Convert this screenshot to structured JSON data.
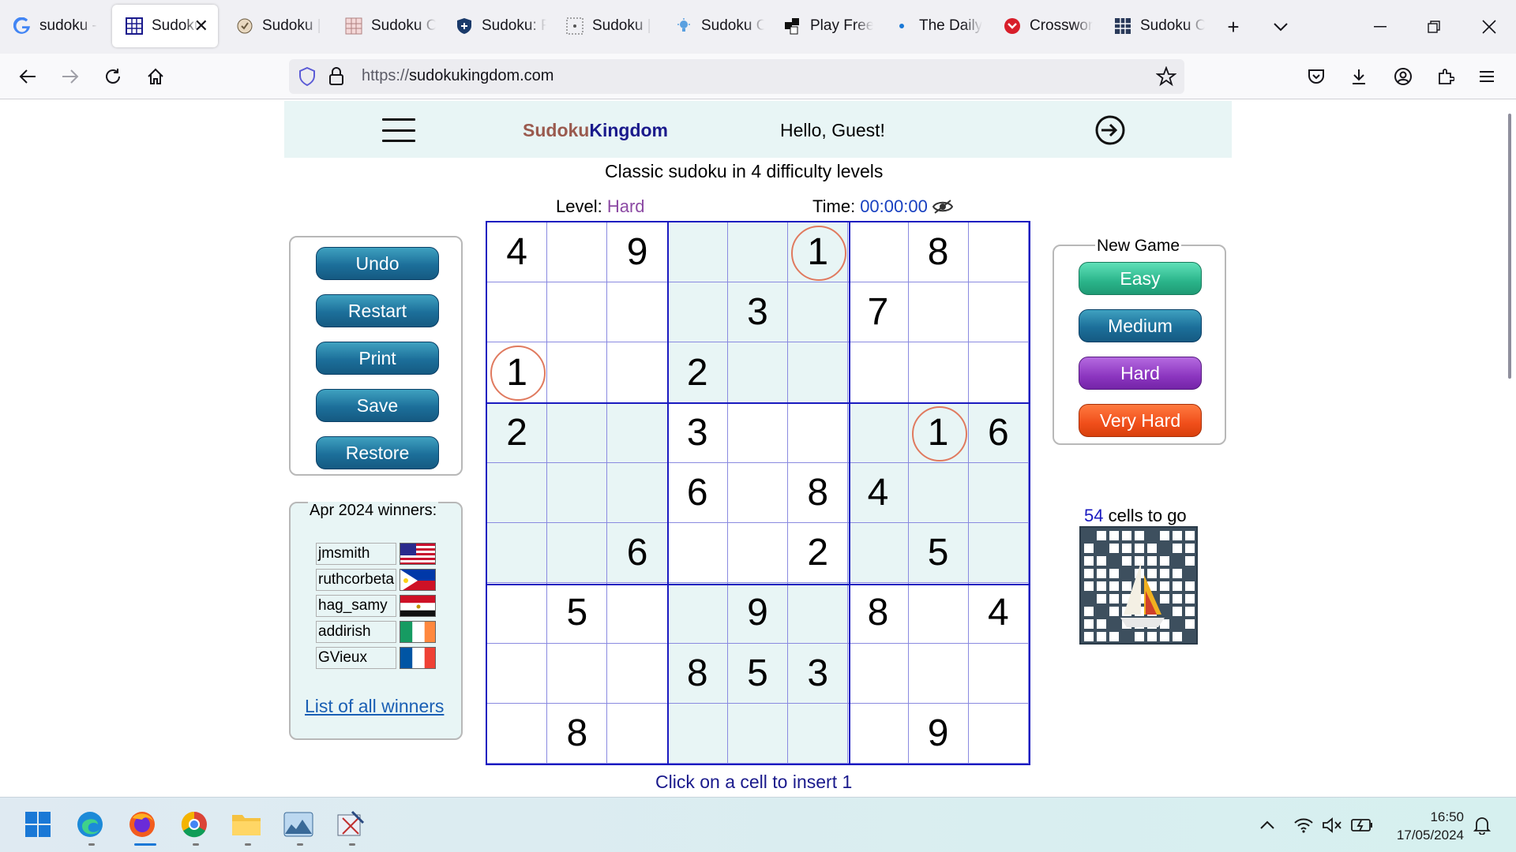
{
  "browser": {
    "tabs": [
      {
        "title": "sudoku -",
        "icon": "google-icon"
      },
      {
        "title": "Sudoku",
        "icon": "sudoku-grid-icon",
        "active": true
      },
      {
        "title": "Sudoku |",
        "icon": "sudoku-hand-icon"
      },
      {
        "title": "Sudoku C",
        "icon": "sudoku-pink-icon"
      },
      {
        "title": "Sudoku: F",
        "icon": "sudoku-shield-icon"
      },
      {
        "title": "Sudoku |",
        "icon": "sudoku-dotted-icon"
      },
      {
        "title": "Sudoku C",
        "icon": "bulb-icon"
      },
      {
        "title": "Play Free",
        "icon": "puzzle-icon"
      },
      {
        "title": "The Daily",
        "icon": "dot-icon"
      },
      {
        "title": "Crosswor",
        "icon": "crossword-icon"
      },
      {
        "title": "Sudoku C",
        "icon": "sudoku-dark-grid-icon"
      }
    ],
    "url_protocol": "https://",
    "url_host": "sudokukingdom.com"
  },
  "header": {
    "logo_part1": "Sudoku",
    "logo_part2": "Kingdom",
    "greeting": "Hello, Guest!"
  },
  "subtitle": "Classic sudoku in 4 difficulty levels",
  "status": {
    "level_label": "Level:",
    "level_value": "Hard",
    "time_label": "Time:",
    "time_value": "00:00:00"
  },
  "controls": {
    "undo": "Undo",
    "restart": "Restart",
    "print": "Print",
    "save": "Save",
    "restore": "Restore"
  },
  "winners": {
    "title": "Apr 2024 winners:",
    "list": [
      {
        "name": "jmsmith",
        "flag": "us"
      },
      {
        "name": "ruthcorbeta",
        "flag": "ph"
      },
      {
        "name": "hag_samy",
        "flag": "eg"
      },
      {
        "name": "addirish",
        "flag": "ie"
      },
      {
        "name": "GVieux",
        "flag": "fr"
      }
    ],
    "link": "List of all winners"
  },
  "grid": {
    "rows": [
      [
        "4",
        "",
        "9",
        "",
        "",
        "1",
        "",
        "8",
        ""
      ],
      [
        "",
        "",
        "",
        "",
        "3",
        "",
        "7",
        "",
        ""
      ],
      [
        "1",
        "",
        "",
        "2",
        "",
        "",
        "",
        "",
        ""
      ],
      [
        "2",
        "",
        "",
        "3",
        "",
        "",
        "",
        "1",
        "6"
      ],
      [
        "",
        "",
        "",
        "6",
        "",
        "8",
        "4",
        "",
        ""
      ],
      [
        "",
        "",
        "6",
        "",
        "",
        "2",
        "",
        "5",
        ""
      ],
      [
        "",
        "5",
        "",
        "",
        "9",
        "",
        "8",
        "",
        "4"
      ],
      [
        "",
        "",
        "",
        "8",
        "5",
        "3",
        "",
        "",
        ""
      ],
      [
        "",
        "8",
        "",
        "",
        "",
        "",
        "",
        "9",
        ""
      ]
    ],
    "highlighted_digit": "1"
  },
  "hint": "Click on a cell to insert 1",
  "new_game": {
    "title": "New Game",
    "easy": "Easy",
    "medium": "Medium",
    "hard": "Hard",
    "very_hard": "Very Hard"
  },
  "progress": {
    "cells_count": "54",
    "cells_label": "cells to go"
  },
  "taskbar": {
    "time": "16:50",
    "date": "17/05/2024"
  },
  "colors": {
    "accent_blue": "#1a1ac0",
    "shade": "#e8f5f5",
    "level_purple": "#8c4aa4",
    "circle": "#e07a5f"
  }
}
